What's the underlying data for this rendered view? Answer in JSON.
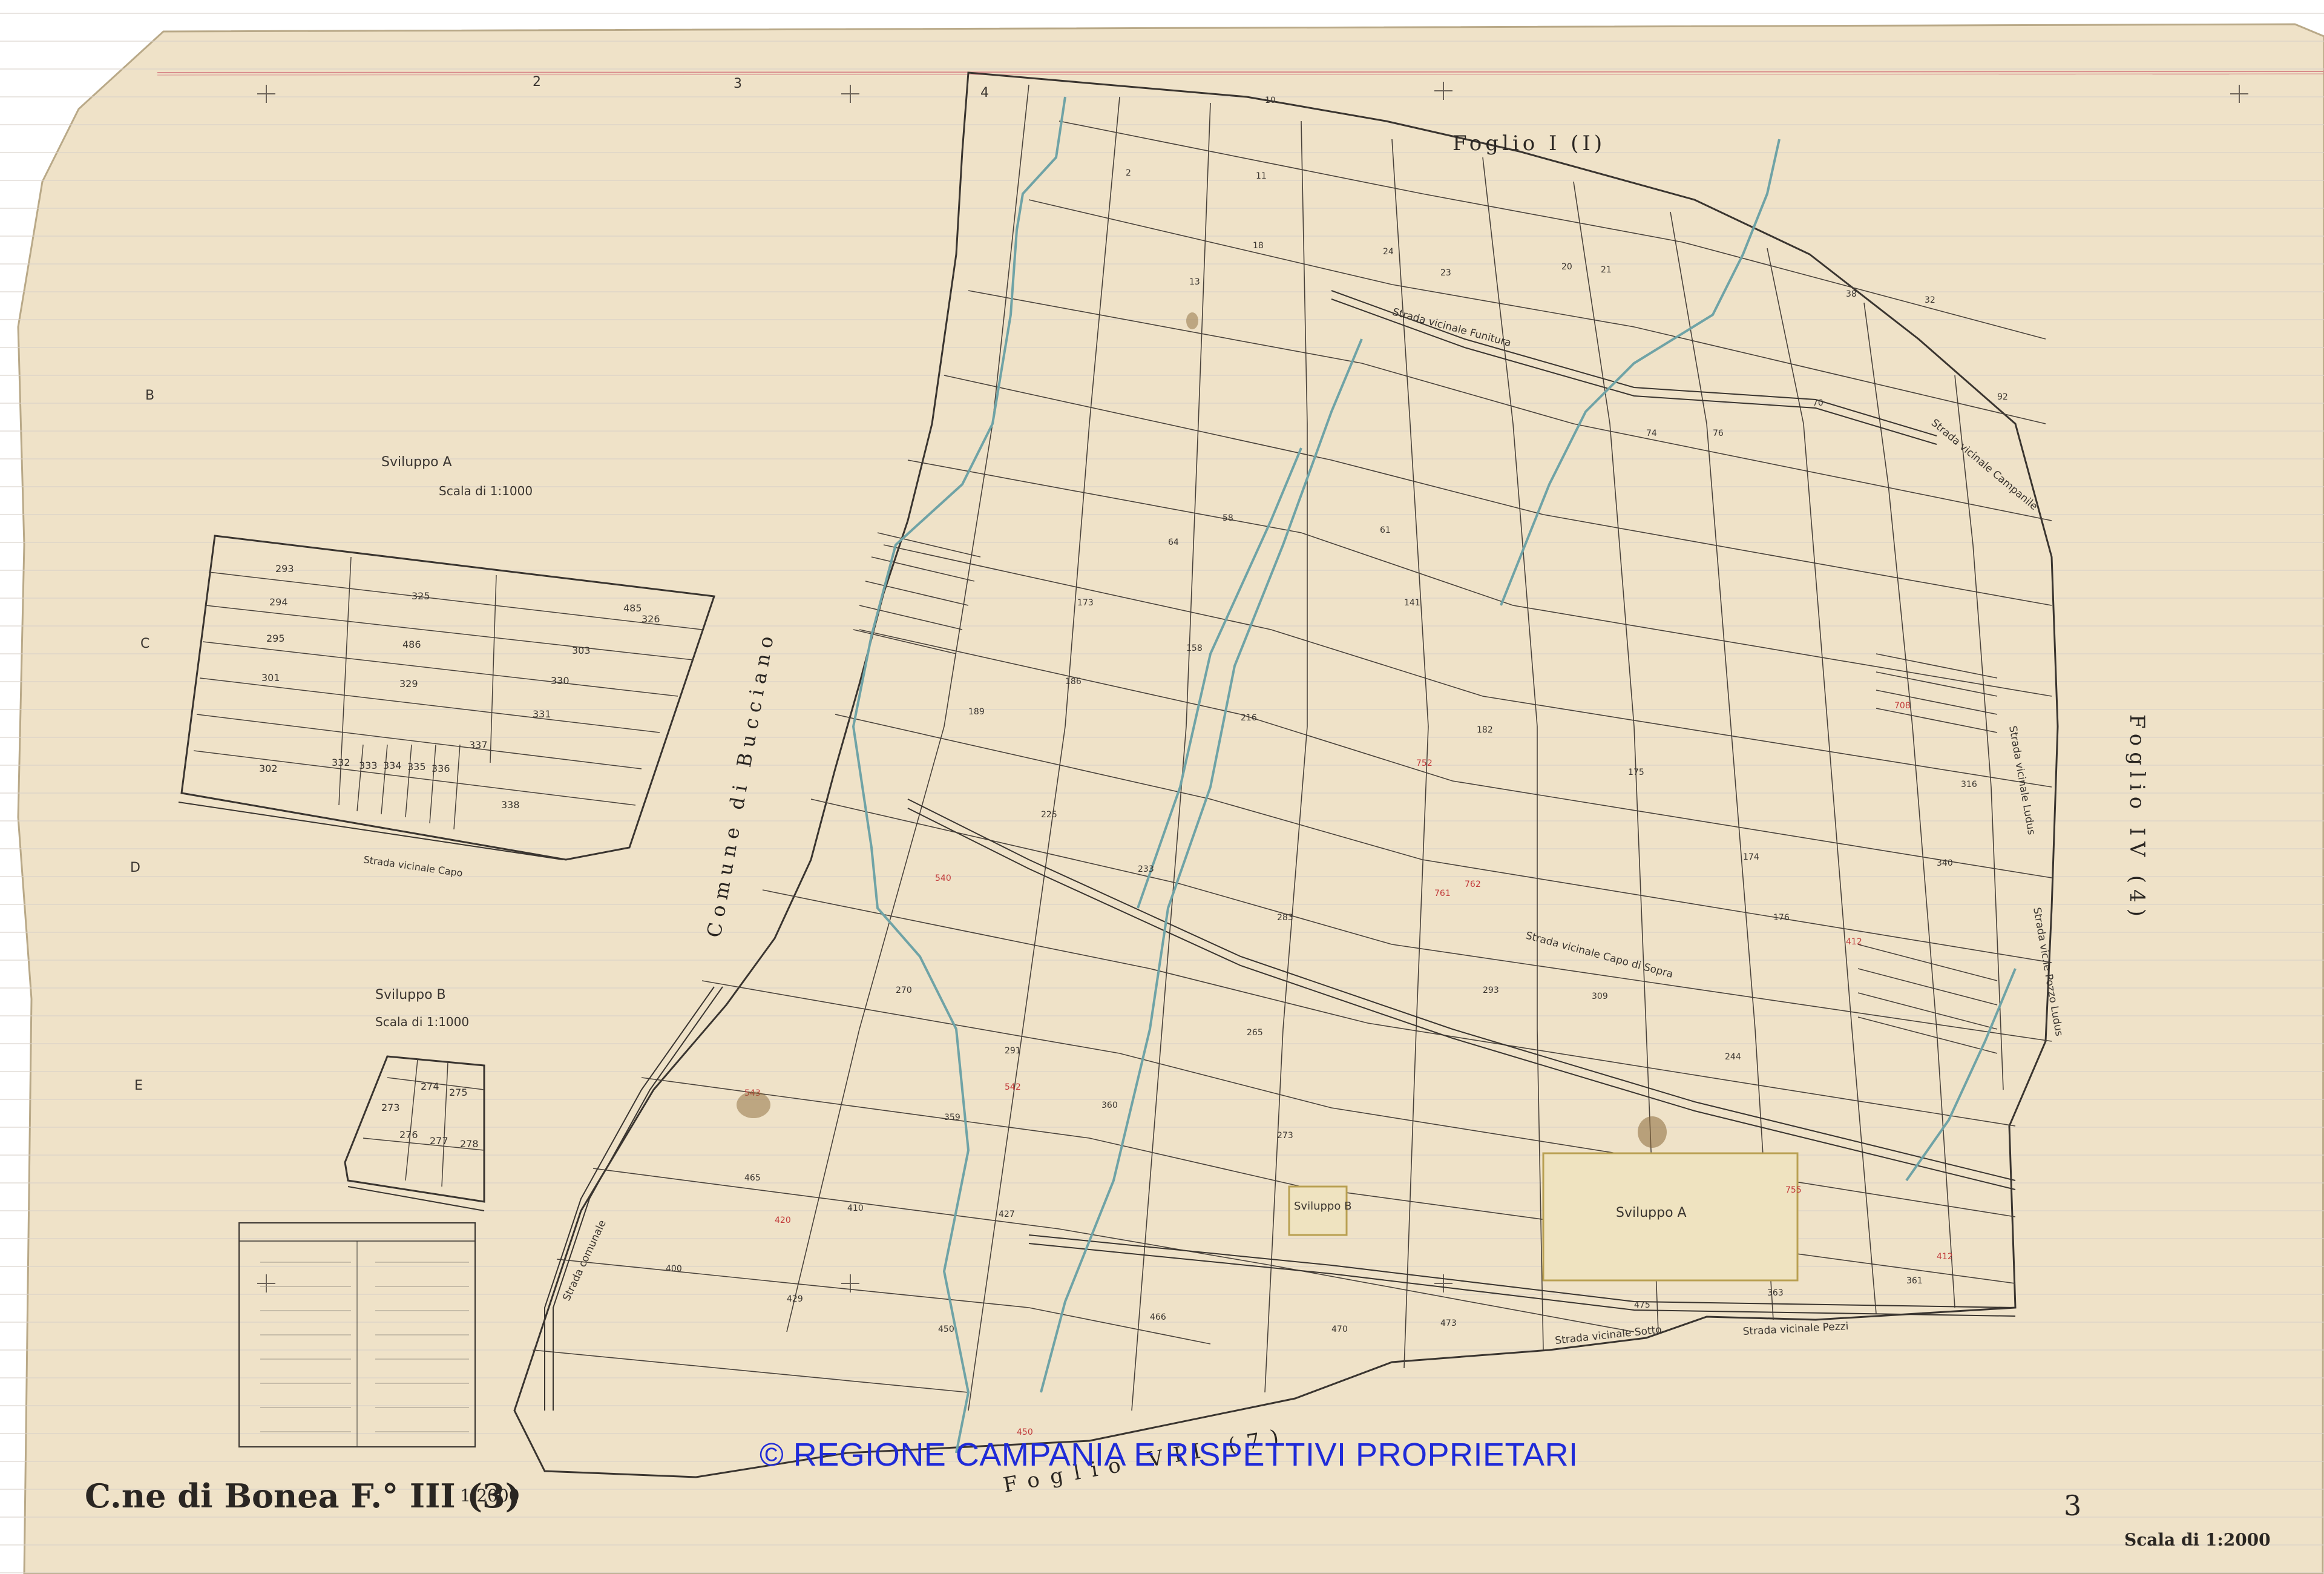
{
  "map": {
    "title_comune": "C.ne di Bonea F.° III (3)",
    "title_scale_note": "1:2000",
    "scale_label": "Scala di 1:2000",
    "sheet_number": "3",
    "copyright": "© REGIONE CAMPANIA E RISPETTIVI PROPRIETARI",
    "neighbor_labels": {
      "north": "Foglio I (I)",
      "east": "Foglio IV (4)",
      "south": "Foglio VII (7)",
      "west": "Comune di Bucciano"
    },
    "insets": [
      {
        "name": "Sviluppo A",
        "scale": "Scala di 1:1000"
      },
      {
        "name": "Sviluppo B",
        "scale": "Scala di 1:1000"
      }
    ],
    "map_boxes": [
      "Sviluppo A",
      "Sviluppo B"
    ],
    "roads": [
      "Strada vicinale Capo",
      "Strada vicinale Capo di Sopra",
      "Strada comunale",
      "Strada vicinale Sotto",
      "Strada vicinale Funitura",
      "Strada vicinale Campanile",
      "Strada vicinale Ludus",
      "Strada vic.le Pozzo Ludus",
      "Strada vicinale Pezzi"
    ],
    "inset_a_parcels": [
      "293",
      "294",
      "295",
      "301",
      "302",
      "325",
      "326",
      "485",
      "486",
      "303",
      "329",
      "330",
      "331",
      "332",
      "333",
      "334",
      "335",
      "336",
      "337",
      "338"
    ],
    "inset_b_parcels": [
      "273",
      "274",
      "275",
      "276",
      "277",
      "278"
    ],
    "grid_letters": [
      "B",
      "C",
      "D",
      "E"
    ],
    "column_numbers": [
      "2",
      "3",
      "4"
    ],
    "colors": {
      "paper": "#efe2c8",
      "ink": "#3a3530",
      "stream": "#6fa3a6",
      "red_annotation": "#c23b3b",
      "copyright": "#1f2bd8"
    }
  }
}
